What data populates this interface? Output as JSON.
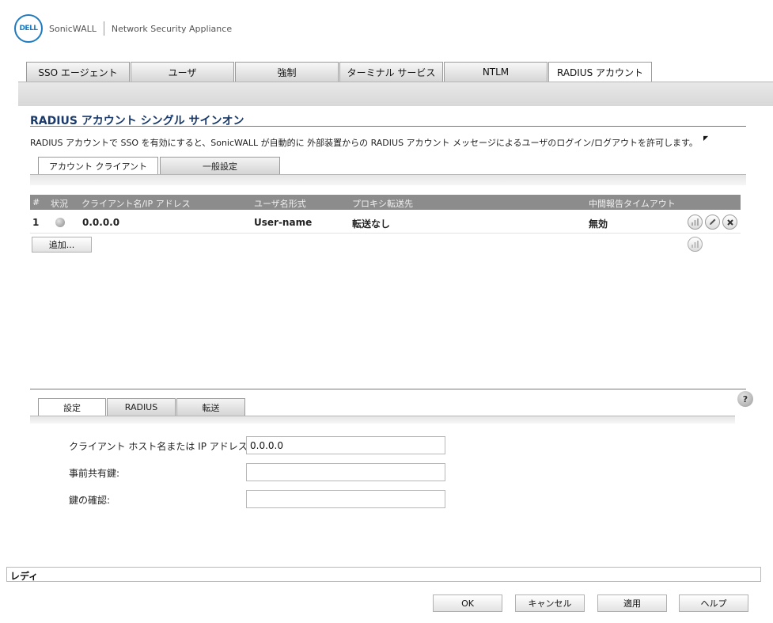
{
  "header": {
    "logo_text": "DELL",
    "brand": "SonicWALL",
    "product": "Network Security Appliance"
  },
  "top_tabs": [
    "SSO エージェント",
    "ユーザ",
    "強制",
    "ターミナル サービス",
    "NTLM",
    "RADIUS アカウント"
  ],
  "section": {
    "title": "RADIUS アカウント シングル サインオン",
    "description": "RADIUS アカウントで SSO を有効にすると、SonicWALL が自動的に 外部装置からの RADIUS アカウント メッセージによるユーザのログイン/ログアウトを許可します。"
  },
  "sub_tabs": [
    "アカウント クライアント",
    "一般設定"
  ],
  "table": {
    "columns": [
      "#",
      "状況",
      "クライアント名/IP アドレス",
      "ユーザ名形式",
      "プロキシ転送先",
      "中間報告タイムアウト"
    ],
    "rows": [
      {
        "num": "1",
        "status": "gray",
        "client": "0.0.0.0",
        "username_format": "User-name",
        "proxy": "転送なし",
        "timeout": "無効"
      }
    ]
  },
  "add_button": "追加...",
  "lower_tabs": [
    "設定",
    "RADIUS",
    "転送"
  ],
  "form": {
    "host_label": "クライアント ホスト名または IP アドレス:",
    "host_value": "0.0.0.0",
    "secret_label": "事前共有鍵:",
    "secret_value": "",
    "confirm_label": "鍵の確認:",
    "confirm_value": ""
  },
  "status_text": "レディ",
  "buttons": {
    "ok": "OK",
    "cancel": "キャンセル",
    "apply": "適用",
    "help": "ヘルプ"
  },
  "help_icon_text": "?",
  "icons": {
    "stats": "stats-icon",
    "edit": "pencil-icon",
    "delete": "close-icon",
    "status": "status-dot-icon"
  },
  "colors": {
    "title": "#1a3a6b",
    "table_header": "#8c8c8c",
    "rule": "#5a7fa8"
  }
}
